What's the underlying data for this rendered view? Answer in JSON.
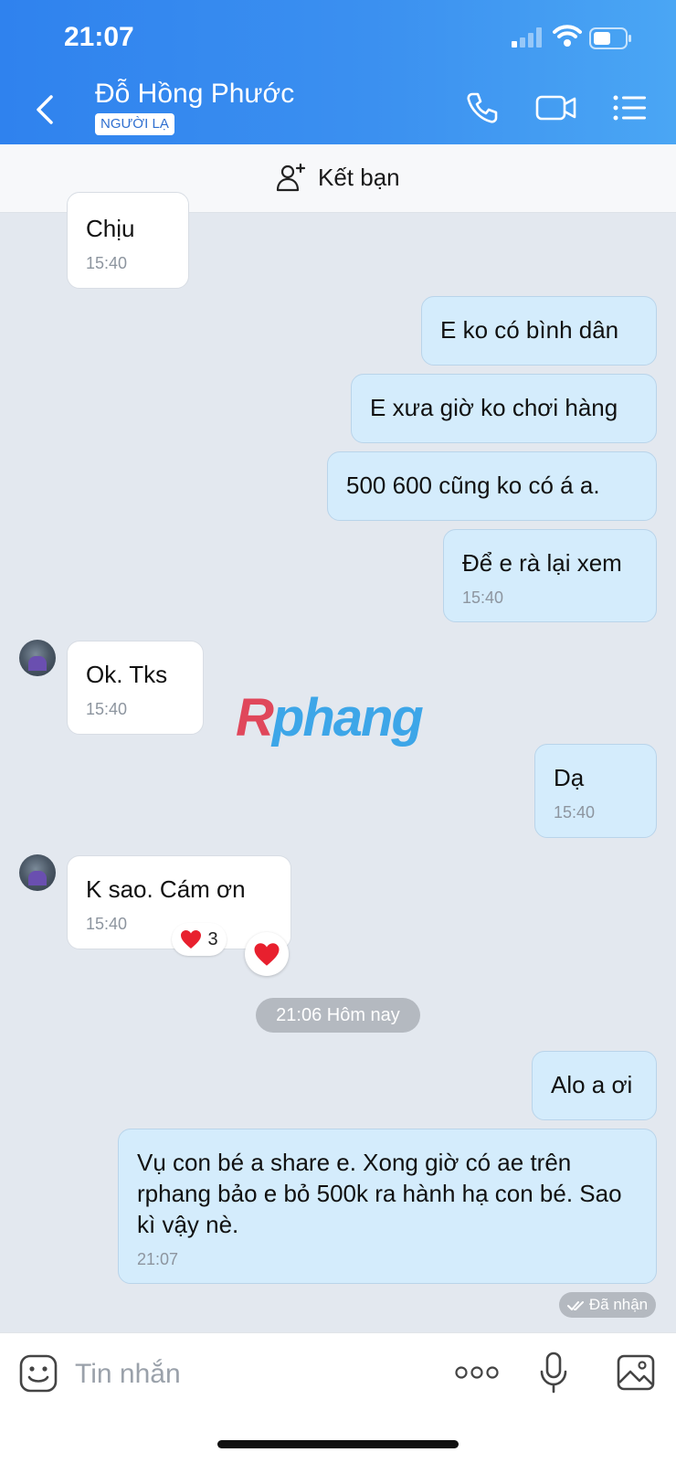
{
  "status_bar": {
    "time": "21:07"
  },
  "header": {
    "contact_name": "Đỗ Hồng Phước",
    "badge": "NGƯỜI LẠ"
  },
  "add_friend": {
    "label": "Kết bạn"
  },
  "messages": [
    {
      "side": "in",
      "text": "Chịu",
      "time": "15:40"
    },
    {
      "side": "out",
      "text": "E ko có bình dân"
    },
    {
      "side": "out",
      "text": "E xưa giờ ko chơi hàng"
    },
    {
      "side": "out",
      "text": "500 600 cũng ko có á a."
    },
    {
      "side": "out",
      "text": "Để e rà lại xem",
      "time": "15:40"
    },
    {
      "side": "in",
      "text": "Ok.  Tks",
      "time": "15:40"
    },
    {
      "side": "out",
      "text": "Dạ",
      "time": "15:40"
    },
    {
      "side": "in",
      "text": "K sao.  Cám ơn",
      "time": "15:40"
    },
    {
      "side": "out",
      "text": "Alo a ơi"
    },
    {
      "side": "out",
      "text": "Vụ con bé a share e. Xong giờ có ae trên rphang bảo e bỏ 500k ra hành hạ con bé. Sao kì vậy nè.",
      "time": "21:07"
    }
  ],
  "reaction": {
    "emoji": "❤️",
    "count": "3"
  },
  "date_separator": "21:06 Hôm nay",
  "delivery_status": "Đã nhận",
  "watermark": {
    "part1": "R",
    "part2": "phang"
  },
  "composer": {
    "placeholder": "Tin nhắn"
  },
  "colors": {
    "header": "#3b90f0",
    "outgoing_bubble": "#d4ecfc",
    "incoming_bubble": "#ffffff",
    "background": "#e3e8ef"
  }
}
